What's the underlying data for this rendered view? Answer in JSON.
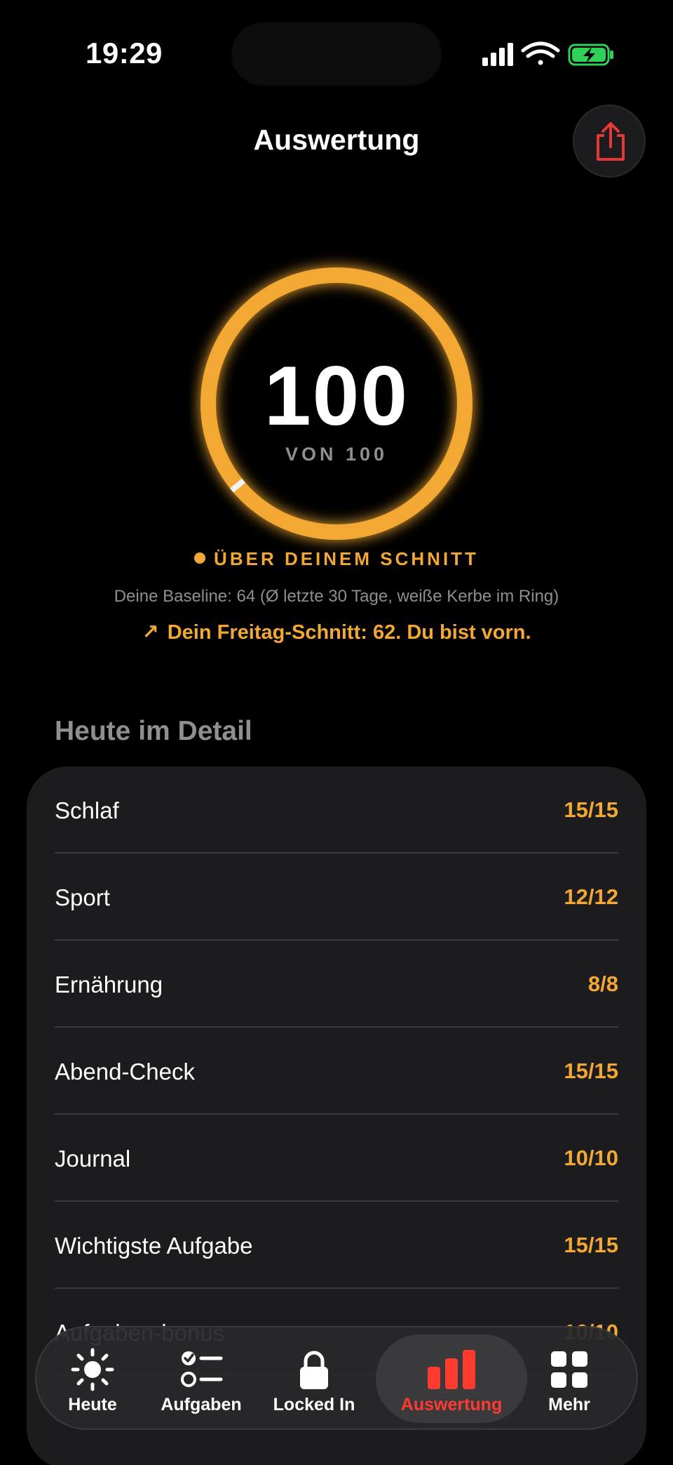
{
  "status_bar": {
    "time": "19:29"
  },
  "header": {
    "title": "Auswertung"
  },
  "score": {
    "value": "100",
    "subtitle": "VON 100",
    "fraction": 1.0,
    "baseline_fraction": 0.64,
    "status": "ÜBER DEINEM SCHNITT",
    "baseline_text": "Deine Baseline: 64 (Ø letzte 30 Tage, weiße Kerbe im Ring)",
    "comparison_text": "Dein Freitag-Schnitt: 62. Du bist vorn.",
    "accent_color": "#f2a832"
  },
  "detail": {
    "title": "Heute im Detail",
    "rows": [
      {
        "label": "Schlaf",
        "value": "15/15"
      },
      {
        "label": "Sport",
        "value": "12/12"
      },
      {
        "label": "Ernährung",
        "value": "8/8"
      },
      {
        "label": "Abend-Check",
        "value": "15/15"
      },
      {
        "label": "Journal",
        "value": "10/10"
      },
      {
        "label": "Wichtigste Aufgabe",
        "value": "15/15"
      },
      {
        "label": "Aufgaben-bonus",
        "value": "10/10"
      }
    ]
  },
  "tabbar": {
    "tabs": [
      {
        "label": "Heute",
        "icon": "sun-icon"
      },
      {
        "label": "Aufgaben",
        "icon": "checklist-icon"
      },
      {
        "label": "Locked In",
        "icon": "lock-icon"
      },
      {
        "label": "Auswertung",
        "icon": "bar-chart-icon",
        "active": true
      },
      {
        "label": "Mehr",
        "icon": "grid-icon"
      }
    ],
    "active_color": "#ff3b30"
  }
}
